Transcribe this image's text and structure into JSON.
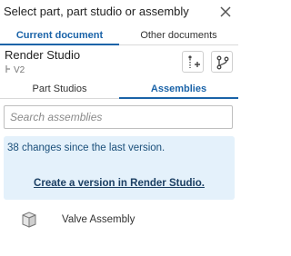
{
  "header": {
    "title": "Select part, part studio or assembly"
  },
  "doc_tabs": [
    {
      "label": "Current document",
      "active": true
    },
    {
      "label": "Other documents",
      "active": false
    }
  ],
  "studio": {
    "name": "Render Studio",
    "version": "V2"
  },
  "sub_tabs": [
    {
      "label": "Part Studios",
      "active": false
    },
    {
      "label": "Assemblies",
      "active": true
    }
  ],
  "search": {
    "placeholder": "Search assemblies",
    "value": ""
  },
  "notice": {
    "message": "38 changes since the last version.",
    "link": "Create a version in Render Studio."
  },
  "items": [
    {
      "label": "Valve Assembly",
      "icon": "assembly-icon"
    }
  ],
  "colors": {
    "accent": "#1a63a8",
    "notice_bg": "#e4f1fb"
  }
}
